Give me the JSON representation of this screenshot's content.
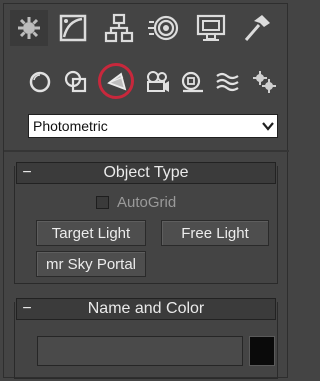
{
  "tabs": [
    {
      "icon": "create-icon",
      "active": true
    },
    {
      "icon": "modify-icon"
    },
    {
      "icon": "hierarchy-icon"
    },
    {
      "icon": "motion-icon"
    },
    {
      "icon": "display-icon"
    },
    {
      "icon": "utilities-icon"
    }
  ],
  "categories": [
    {
      "icon": "geometry-icon"
    },
    {
      "icon": "shapes-icon"
    },
    {
      "icon": "lights-icon",
      "selected": true
    },
    {
      "icon": "cameras-icon"
    },
    {
      "icon": "helpers-icon"
    },
    {
      "icon": "space-warps-icon"
    },
    {
      "icon": "systems-icon"
    }
  ],
  "type_dropdown": {
    "value": "Photometric"
  },
  "object_type": {
    "header_minus": "−",
    "title": "Object Type",
    "autogrid_label": "AutoGrid",
    "autogrid_checked": false,
    "buttons": {
      "target_light": "Target Light",
      "free_light": "Free Light",
      "mr_sky_portal": "mr Sky Portal"
    }
  },
  "name_and_color": {
    "header_minus": "−",
    "title": "Name and Color",
    "name_value": "",
    "color_swatch": "#0a0a0a"
  },
  "colors": {
    "panel_bg": "#444444",
    "selection_ring": "#c8283c"
  }
}
